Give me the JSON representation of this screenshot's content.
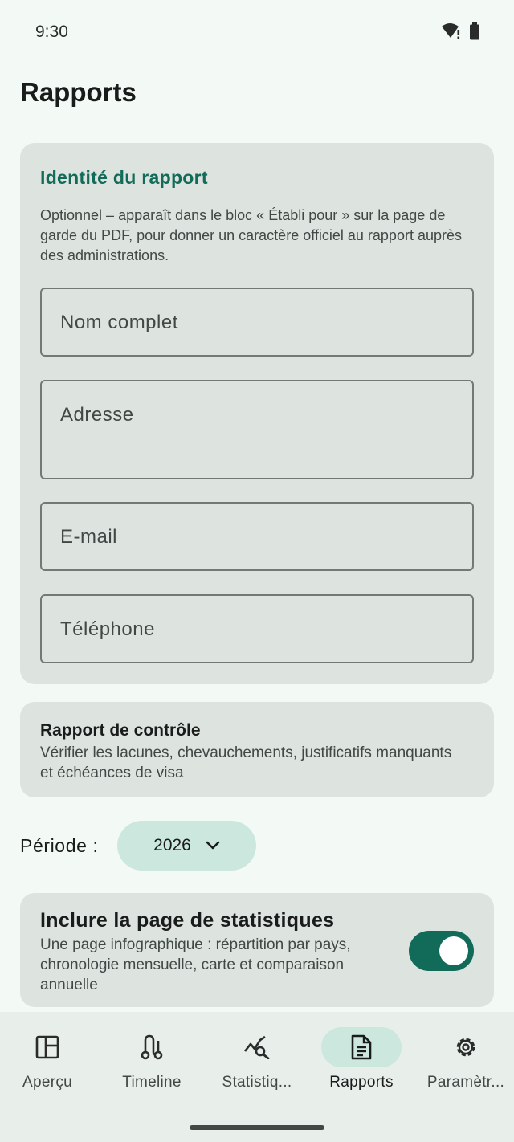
{
  "status_bar": {
    "time": "9:30",
    "icons": [
      "wifi-alert-icon",
      "battery-icon"
    ]
  },
  "page": {
    "title": "Rapports"
  },
  "identity_card": {
    "title": "Identité du rapport",
    "description": "Optionnel – apparaît dans le bloc « Établi pour » sur la page de garde du PDF, pour donner un caractère officiel au rapport auprès des administrations.",
    "fields": {
      "name": {
        "label": "Nom complet",
        "value": ""
      },
      "address": {
        "label": "Adresse",
        "value": ""
      },
      "email": {
        "label": "E-mail",
        "value": ""
      },
      "phone": {
        "label": "Téléphone",
        "value": ""
      }
    }
  },
  "control_card": {
    "title": "Rapport de contrôle",
    "description": "Vérifier les lacunes, chevauchements, justificatifs manquants et échéances de visa"
  },
  "period": {
    "label": "Période :",
    "value": "2026"
  },
  "stats_card": {
    "title": "Inclure la page de statistiques",
    "description": "Une page infographique : répartition par pays, chronologie mensuelle, carte et comparaison annuelle",
    "enabled": true
  },
  "colors": {
    "accent": "#116b58",
    "chip": "#cce8de",
    "card": "#dde3df",
    "background": "#f3f9f5"
  },
  "bottom_nav": {
    "items": [
      {
        "label": "Aperçu",
        "icon": "dashboard-icon"
      },
      {
        "label": "Timeline",
        "icon": "timeline-icon"
      },
      {
        "label": "Statistiq...",
        "icon": "analytics-icon"
      },
      {
        "label": "Rapports",
        "icon": "document-icon",
        "active": true
      },
      {
        "label": "Paramètr...",
        "icon": "gear-icon"
      }
    ]
  }
}
